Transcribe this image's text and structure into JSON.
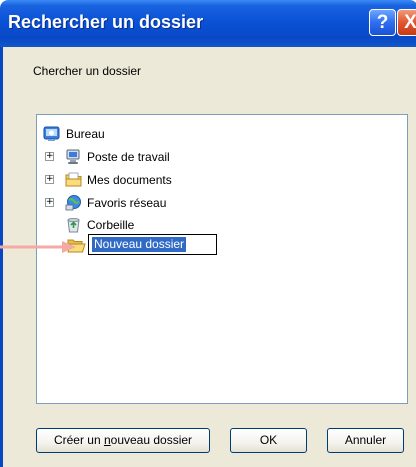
{
  "window": {
    "title": "Rechercher un dossier",
    "help_symbol": "?",
    "close_symbol": "X"
  },
  "dialog": {
    "description": "Chercher un dossier"
  },
  "tree": {
    "items": [
      {
        "label": "Bureau",
        "icon": "desktop-icon",
        "expandable": false
      },
      {
        "label": "Poste de travail",
        "icon": "computer-icon",
        "expandable": true
      },
      {
        "label": "Mes documents",
        "icon": "documents-folder-icon",
        "expandable": true
      },
      {
        "label": "Favoris réseau",
        "icon": "network-places-icon",
        "expandable": true
      },
      {
        "label": "Corbeille",
        "icon": "recycle-bin-icon",
        "expandable": false
      }
    ],
    "new_folder": {
      "value": "Nouveau dossier",
      "icon": "open-folder-icon"
    }
  },
  "buttons": {
    "new_folder_before": "Créer un ",
    "new_folder_mnemonic": "n",
    "new_folder_after": "ouveau dossier",
    "ok": "OK",
    "cancel": "Annuler"
  },
  "colors": {
    "titlebar": "#0a52d6",
    "dialog_background": "#ece9d8",
    "selection": "#316ac5",
    "annotation_arrow": "#f4a9a3"
  }
}
